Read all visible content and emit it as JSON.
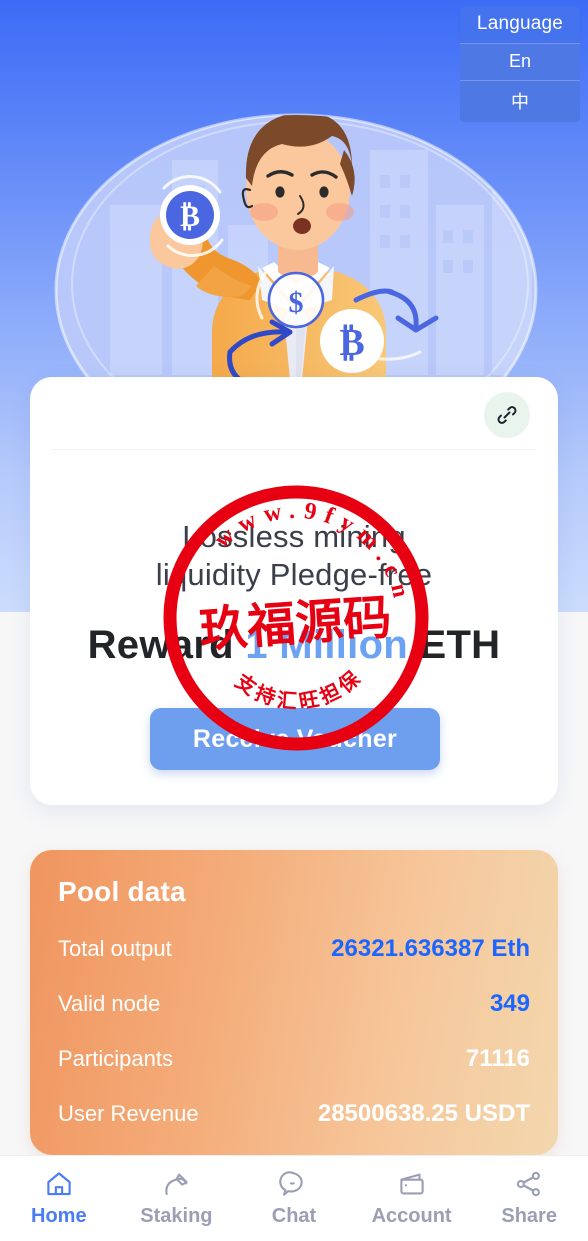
{
  "language_switcher": {
    "title": "Language",
    "options": [
      "En",
      "中"
    ]
  },
  "hero": {
    "illustration_name": "man-holding-bitcoin-illustration"
  },
  "promo_card": {
    "link_icon": "chain-link-icon",
    "line1": "Lossless mining",
    "line2": "liquidity Pledge-free",
    "headline_prefix": "Reward ",
    "headline_highlight": "1 Million",
    "headline_suffix": " ETH",
    "cta_label": "Receive Voucher",
    "highlight_color": "#6ba2f1",
    "cta_color": "#6e9eee"
  },
  "pool_data": {
    "title": "Pool data",
    "rows": [
      {
        "label": "Total output",
        "value": "26321.636387 Eth",
        "color": "blue"
      },
      {
        "label": "Valid node",
        "value": "349",
        "color": "blue"
      },
      {
        "label": "Participants",
        "value": "71116",
        "color": "white"
      },
      {
        "label": "User Revenue",
        "value": "28500638.25 USDT",
        "color": "white"
      }
    ],
    "accent_blue": "#1a66ff"
  },
  "bottom_nav": {
    "items": [
      {
        "label": "Home",
        "icon": "home-icon",
        "active": true
      },
      {
        "label": "Staking",
        "icon": "pickaxe-icon",
        "active": false
      },
      {
        "label": "Chat",
        "icon": "chat-bubble-icon",
        "active": false
      },
      {
        "label": "Account",
        "icon": "wallet-icon",
        "active": false
      },
      {
        "label": "Share",
        "icon": "share-nodes-icon",
        "active": false
      }
    ],
    "active_color": "#4a7df5",
    "inactive_color": "#9a9fb4"
  },
  "watermark": {
    "center_text": "玖福源码",
    "arc_text": "www.9fym.cn",
    "bottom_text": "支持汇旺担保",
    "color": "#e60012"
  }
}
